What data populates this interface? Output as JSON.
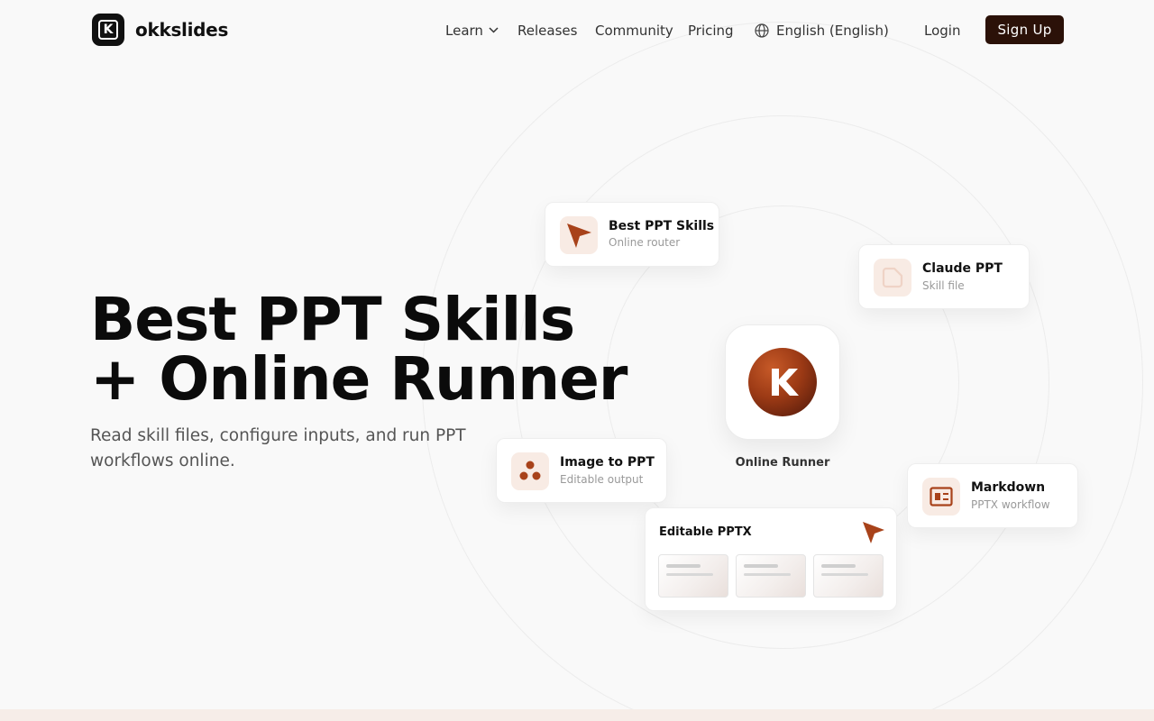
{
  "brand": {
    "name": "okkslides",
    "logo_letter": "K"
  },
  "nav": {
    "learn": "Learn",
    "releases": "Releases",
    "community": "Community",
    "pricing": "Pricing",
    "language": "English (English)",
    "login": "Login",
    "signup": "Sign Up"
  },
  "hero": {
    "title_line1": "Best PPT Skills",
    "title_line2": "+ Online Runner",
    "subtitle": "Read skill files, configure inputs, and run PPT workflows online."
  },
  "cards": {
    "best": {
      "title": "Best PPT Skills",
      "subtitle": "Online router",
      "icon": "cursor-arrow-icon"
    },
    "claude": {
      "title": "Claude PPT",
      "subtitle": "Skill file",
      "icon": "file-icon"
    },
    "image": {
      "title": "Image to PPT",
      "subtitle": "Editable output",
      "icon": "molecule-icon"
    },
    "markdown": {
      "title": "Markdown",
      "subtitle": "PPTX workflow",
      "icon": "slides-icon"
    },
    "pptx": {
      "title": "Editable PPTX",
      "icon": "cursor-arrow-icon"
    }
  },
  "runner": {
    "label": "Online Runner",
    "logo_letter": "K"
  },
  "colors": {
    "accent": "#a8421a",
    "accent_dark": "#2b1108",
    "icon_bg": "#f8ebe4",
    "band": "#f6ede8"
  }
}
